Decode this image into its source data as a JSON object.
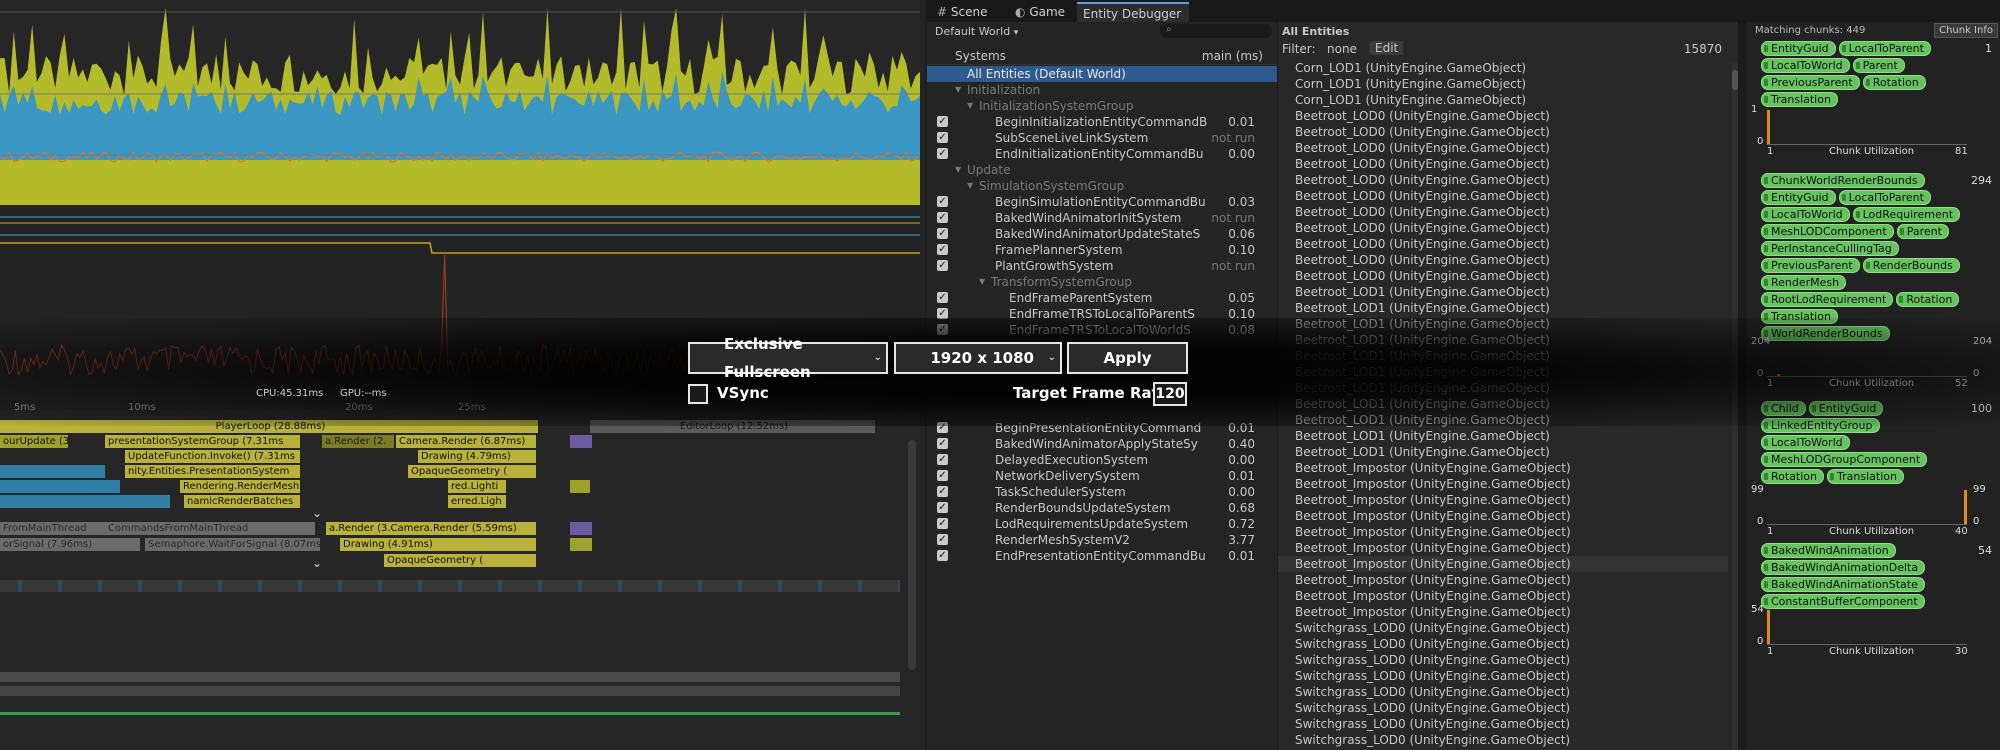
{
  "profiler": {
    "cpu_label": "CPU:45.31ms",
    "gpu_label": "GPU:--ms",
    "ms_markers": [
      "5ms",
      "10ms",
      "20ms",
      "25ms"
    ],
    "rows": [
      "PlayerLoop (28.88ms)",
      "EditorLoop (12.52ms)",
      "ourUpdate (3.",
      "presentationSystemGroup (7.31ms",
      "a.Render (2.",
      "Camera.Render (6.87ms)",
      "UpdateFunction.Invoke() (7.31ms",
      "Drawing (4.79ms)",
      "nity.Entities.PresentationSystem",
      "OpaqueGeometry (",
      "Rendering.RenderMesh",
      "red.Lighti",
      "namicRenderBatches",
      "erred.Ligh",
      "FromMainThread",
      "CommandsFromMainThread",
      "a.Render (3.Camera.Render (5.59ms)",
      "orSignal (7.96ms)",
      "Semaphore.WaitForSignal (8.07ms)",
      "Drawing (4.91ms)",
      "OpaqueGeometry ("
    ]
  },
  "dialog": {
    "mode_label": "Exclusive Fullscreen",
    "resolution_label": "1920 x 1080",
    "apply_label": "Apply",
    "vsync_label": "VSync",
    "target_label": "Target Frame Rate",
    "target_value": "120"
  },
  "tabs": [
    {
      "label": "Scene",
      "icon": "hash-icon"
    },
    {
      "label": "Game",
      "icon": "game-icon"
    },
    {
      "label": "Entity Debugger",
      "icon": ""
    }
  ],
  "systems": {
    "world_dropdown": "Default World",
    "header_label": "Systems",
    "header_time": "main (ms)",
    "rows": [
      {
        "name": "All Entities (Default World)",
        "time": "",
        "indent": 0,
        "check": false,
        "selected": true
      },
      {
        "name": "Initialization",
        "time": "",
        "indent": 1,
        "check": false,
        "group": true
      },
      {
        "name": "InitializationSystemGroup",
        "time": "",
        "indent": 2,
        "check": false,
        "group": true
      },
      {
        "name": "BeginInitializationEntityCommandB",
        "time": "0.01",
        "indent": 3,
        "check": true
      },
      {
        "name": "SubSceneLiveLinkSystem",
        "time": "not run",
        "indent": 3,
        "check": true
      },
      {
        "name": "EndInitializationEntityCommandBu",
        "time": "0.00",
        "indent": 3,
        "check": true
      },
      {
        "name": "Update",
        "time": "",
        "indent": 1,
        "check": false,
        "group": true
      },
      {
        "name": "SimulationSystemGroup",
        "time": "",
        "indent": 2,
        "check": false,
        "group": true
      },
      {
        "name": "BeginSimulationEntityCommandBu",
        "time": "0.03",
        "indent": 3,
        "check": true
      },
      {
        "name": "BakedWindAnimatorInitSystem",
        "time": "not run",
        "indent": 3,
        "check": true
      },
      {
        "name": "BakedWindAnimatorUpdateStateS",
        "time": "0.06",
        "indent": 3,
        "check": true
      },
      {
        "name": "FramePlannerSystem",
        "time": "0.10",
        "indent": 3,
        "check": true
      },
      {
        "name": "PlantGrowthSystem",
        "time": "not run",
        "indent": 3,
        "check": true
      },
      {
        "name": "TransformSystemGroup",
        "time": "",
        "indent": 3,
        "check": false,
        "group": true
      },
      {
        "name": "EndFrameParentSystem",
        "time": "0.05",
        "indent": 4,
        "check": true
      },
      {
        "name": "EndFrameTRSToLocalToParentS",
        "time": "0.10",
        "indent": 4,
        "check": true
      },
      {
        "name": "EndFrameTRSToLocalToWorldS",
        "time": "0.08",
        "indent": 4,
        "check": true
      }
    ],
    "rows_bottom": [
      {
        "name": "BeginPresentationEntityCommand",
        "time": "0.01"
      },
      {
        "name": "BakedWindAnimatorApplyStateSy",
        "time": "0.40"
      },
      {
        "name": "DelayedExecutionSystem",
        "time": "0.00"
      },
      {
        "name": "NetworkDeliverySystem",
        "time": "0.01"
      },
      {
        "name": "TaskSchedulerSystem",
        "time": "0.00"
      },
      {
        "name": "RenderBoundsUpdateSystem",
        "time": "0.68"
      },
      {
        "name": "LodRequirementsUpdateSystem",
        "time": "0.72"
      },
      {
        "name": "RenderMeshSystemV2",
        "time": "3.77"
      },
      {
        "name": "EndPresentationEntityCommandBu",
        "time": "0.01"
      }
    ]
  },
  "entities": {
    "header": "All Entities",
    "filter_label": "Filter:",
    "filter_value": "none",
    "edit_label": "Edit",
    "count": "15870",
    "rows": [
      "Corn_LOD1 (UnityEngine.GameObject)",
      "Corn_LOD1 (UnityEngine.GameObject)",
      "Corn_LOD1 (UnityEngine.GameObject)",
      "Beetroot_LOD0 (UnityEngine.GameObject)",
      "Beetroot_LOD0 (UnityEngine.GameObject)",
      "Beetroot_LOD0 (UnityEngine.GameObject)",
      "Beetroot_LOD0 (UnityEngine.GameObject)",
      "Beetroot_LOD0 (UnityEngine.GameObject)",
      "Beetroot_LOD0 (UnityEngine.GameObject)",
      "Beetroot_LOD0 (UnityEngine.GameObject)",
      "Beetroot_LOD0 (UnityEngine.GameObject)",
      "Beetroot_LOD0 (UnityEngine.GameObject)",
      "Beetroot_LOD0 (UnityEngine.GameObject)",
      "Beetroot_LOD0 (UnityEngine.GameObject)",
      "Beetroot_LOD1 (UnityEngine.GameObject)",
      "Beetroot_LOD1 (UnityEngine.GameObject)",
      "Beetroot_LOD1 (UnityEngine.GameObject)",
      "Beetroot_LOD1 (UnityEngine.GameObject)",
      "Beetroot_LOD1 (UnityEngine.GameObject)",
      "Beetroot_LOD1 (UnityEngine.GameObject)",
      "Beetroot_LOD1 (UnityEngine.GameObject)",
      "Beetroot_LOD1 (UnityEngine.GameObject)",
      "Beetroot_LOD1 (UnityEngine.GameObject)",
      "Beetroot_LOD1 (UnityEngine.GameObject)",
      "Beetroot_LOD1 (UnityEngine.GameObject)",
      "Beetroot_Impostor (UnityEngine.GameObject)",
      "Beetroot_Impostor (UnityEngine.GameObject)",
      "Beetroot_Impostor (UnityEngine.GameObject)",
      "Beetroot_Impostor (UnityEngine.GameObject)",
      "Beetroot_Impostor (UnityEngine.GameObject)",
      "Beetroot_Impostor (UnityEngine.GameObject)",
      "Beetroot_Impostor (UnityEngine.GameObject)",
      "Beetroot_Impostor (UnityEngine.GameObject)",
      "Beetroot_Impostor (UnityEngine.GameObject)",
      "Beetroot_Impostor (UnityEngine.GameObject)",
      "Switchgrass_LOD0 (UnityEngine.GameObject)",
      "Switchgrass_LOD0 (UnityEngine.GameObject)",
      "Switchgrass_LOD0 (UnityEngine.GameObject)",
      "Switchgrass_LOD0 (UnityEngine.GameObject)",
      "Switchgrass_LOD0 (UnityEngine.GameObject)",
      "Switchgrass_LOD0 (UnityEngine.GameObject)",
      "Switchgrass_LOD0 (UnityEngine.GameObject)",
      "Switchgrass_LOD0 (UnityEngine.GameObject)",
      "Switchgrass_LOD0 (UnityEngine.GameObject)"
    ]
  },
  "chunk_info": {
    "matching_label": "Matching chunks: 449",
    "button_label": "Chunk Info",
    "groups": [
      {
        "components": [
          "EntityGuid",
          "LocalToParent",
          "LocalToWorld",
          "Parent",
          "PreviousParent",
          "Rotation",
          "Translation"
        ],
        "count": "1",
        "y_max": "1",
        "y_min": "0",
        "x_min": "1",
        "x_max": "81",
        "right_max": "",
        "right_min": "",
        "util_label": "Chunk Utilization"
      },
      {
        "components": [
          "ChunkWorldRenderBounds",
          "EntityGuid",
          "LocalToParent",
          "LocalToWorld",
          "LodRequirement",
          "MeshLODComponent",
          "Parent",
          "PerInstanceCullingTag",
          "PreviousParent",
          "RenderBounds",
          "RenderMesh",
          "RootLodRequirement",
          "Rotation",
          "Translation",
          "WorldRenderBounds"
        ],
        "count": "294",
        "y_max": "204",
        "y_min": "0",
        "x_min": "1",
        "x_max": "52",
        "right_max": "204",
        "right_min": "0",
        "util_label": "Chunk Utilization"
      },
      {
        "components": [
          "Child",
          "EntityGuid",
          "LinkedEntityGroup",
          "LocalToWorld",
          "MeshLODGroupComponent",
          "Rotation",
          "Translation"
        ],
        "count": "100",
        "y_max": "99",
        "y_min": "0",
        "x_min": "1",
        "x_max": "40",
        "right_max": "99",
        "right_min": "0",
        "util_label": "Chunk Utilization"
      },
      {
        "components": [
          "BakedWindAnimation",
          "BakedWindAnimationDelta",
          "BakedWindAnimationState",
          "ConstantBufferComponent"
        ],
        "count": "54",
        "y_max": "54",
        "y_min": "0",
        "x_min": "1",
        "x_max": "30",
        "right_max": "",
        "right_min": "",
        "util_label": "Chunk Utilization"
      }
    ]
  },
  "colors": {
    "accent": "#2f5a8e",
    "pill": "#66c35f",
    "bar_orange": "#e08a1e"
  }
}
